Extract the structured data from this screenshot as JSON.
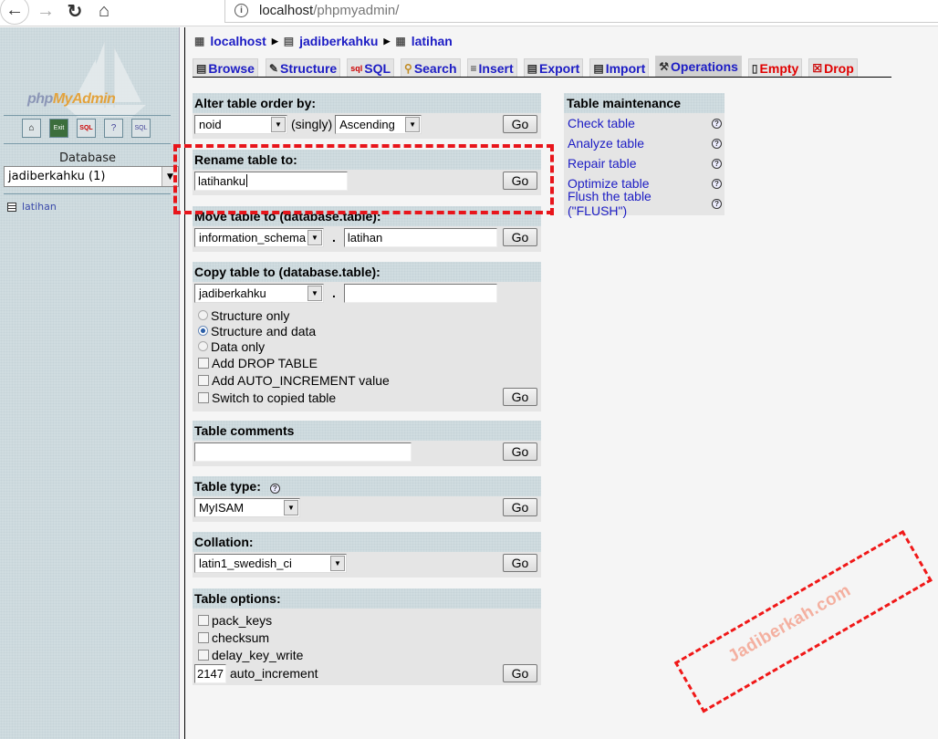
{
  "browser": {
    "url_host": "localhost",
    "url_path": "/phpmyadmin/",
    "icons": [
      "back-arrow-icon",
      "forward-arrow-icon",
      "reload-icon",
      "home-icon",
      "info-icon"
    ]
  },
  "sidebar": {
    "logo_text_a": "php",
    "logo_text_b": "MyAdmin",
    "icon_buttons": [
      "home-icon",
      "exit-icon",
      "sql-query-icon",
      "help-docs-icon",
      "sql-docs-icon"
    ],
    "database_label": "Database",
    "database_selected": "jadiberkahku (1)",
    "tables": [
      {
        "label": "latihan"
      }
    ]
  },
  "breadcrumb": {
    "items": [
      {
        "label": "localhost",
        "icon": "server-icon"
      },
      {
        "label": "jadiberkahku",
        "icon": "database-icon"
      },
      {
        "label": "latihan",
        "icon": "table-icon"
      }
    ]
  },
  "tabs": [
    {
      "label": "Browse",
      "icon": "browse-icon",
      "active": false,
      "danger": false
    },
    {
      "label": "Structure",
      "icon": "structure-icon",
      "active": false,
      "danger": false
    },
    {
      "label": "SQL",
      "icon": "sql-icon",
      "active": false,
      "danger": false
    },
    {
      "label": "Search",
      "icon": "search-icon",
      "active": false,
      "danger": false
    },
    {
      "label": "Insert",
      "icon": "insert-icon",
      "active": false,
      "danger": false
    },
    {
      "label": "Export",
      "icon": "export-icon",
      "active": false,
      "danger": false
    },
    {
      "label": "Import",
      "icon": "import-icon",
      "active": false,
      "danger": false
    },
    {
      "label": "Operations",
      "icon": "tools-icon",
      "active": true,
      "danger": false
    },
    {
      "label": "Empty",
      "icon": "trash-icon",
      "active": false,
      "danger": true
    },
    {
      "label": "Drop",
      "icon": "drop-icon",
      "active": false,
      "danger": true
    }
  ],
  "alter_order": {
    "title": "Alter table order by:",
    "column": "noid",
    "singly": "(singly)",
    "direction": "Ascending",
    "go": "Go"
  },
  "rename": {
    "title": "Rename table to:",
    "value": "latihanku",
    "go": "Go"
  },
  "move": {
    "title": "Move table to (database.table):",
    "database": "information_schema",
    "dot": ".",
    "table": "latihan",
    "go": "Go"
  },
  "copy": {
    "title": "Copy table to (database.table):",
    "database": "jadiberkahku",
    "dot": ".",
    "table": "",
    "radios": [
      {
        "label": "Structure only",
        "checked": false
      },
      {
        "label": "Structure and data",
        "checked": true
      },
      {
        "label": "Data only",
        "checked": false
      }
    ],
    "checkboxes": [
      {
        "label": "Add DROP TABLE",
        "checked": false
      },
      {
        "label": "Add AUTO_INCREMENT value",
        "checked": false
      },
      {
        "label": "Switch to copied table",
        "checked": false
      }
    ],
    "go": "Go"
  },
  "comments": {
    "title": "Table comments",
    "value": "",
    "go": "Go"
  },
  "table_type": {
    "title": "Table type:",
    "value": "MyISAM",
    "go": "Go"
  },
  "collation": {
    "title": "Collation:",
    "value": "latin1_swedish_ci",
    "go": "Go"
  },
  "table_options": {
    "title": "Table options:",
    "checkboxes": [
      {
        "label": "pack_keys",
        "checked": false
      },
      {
        "label": "checksum",
        "checked": false
      },
      {
        "label": "delay_key_write",
        "checked": false
      }
    ],
    "auto_increment_value": "2147",
    "auto_increment_label": "auto_increment",
    "go": "Go"
  },
  "maintenance": {
    "title": "Table maintenance",
    "items": [
      {
        "label": "Check table"
      },
      {
        "label": "Analyze table"
      },
      {
        "label": "Repair table"
      },
      {
        "label": "Optimize table"
      },
      {
        "label": "Flush the table (\"FLUSH\")"
      }
    ]
  },
  "watermark": {
    "text": "Jadiberkah.com"
  },
  "colors": {
    "link": "#1c1cc4",
    "danger": "#e00000",
    "highlight_dash": "#e8151b",
    "panel_head": "#d0dce0",
    "panel_body": "#e5e5e5"
  }
}
